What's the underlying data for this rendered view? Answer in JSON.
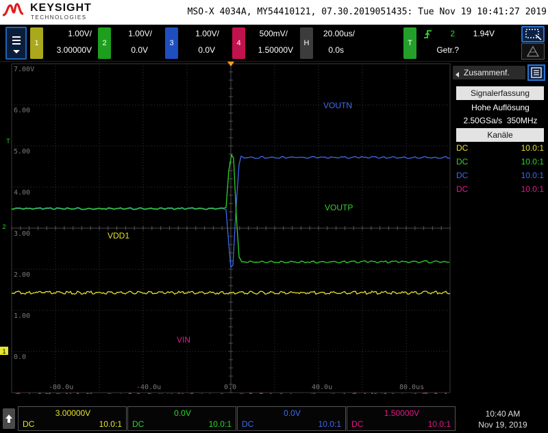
{
  "header": {
    "brand": "KEYSIGHT",
    "brand_sub": "TECHNOLOGIES",
    "status_line": "MSO-X 4034A, MY54410121, 07.30.2019051435: Tue Nov 19 10:41:27 2019"
  },
  "colors": {
    "ch1": "#e6e62a",
    "ch2": "#2fd62a",
    "ch3": "#3f6bf0",
    "ch4": "#e4178a",
    "grid": "#3a3a3a",
    "trigger": "#ff9e1b",
    "dim_text": "#7a7a7a"
  },
  "channels": [
    {
      "num": "1",
      "scale": "1.00V/",
      "offset": "3.00000V"
    },
    {
      "num": "2",
      "scale": "1.00V/",
      "offset": "0.0V"
    },
    {
      "num": "3",
      "scale": "1.00V/",
      "offset": "0.0V"
    },
    {
      "num": "4",
      "scale": "500mV/",
      "offset": "1.50000V"
    }
  ],
  "horizontal": {
    "label": "H",
    "scale": "20.00us/",
    "delay": "0.0s"
  },
  "trigger": {
    "label": "T",
    "edge_icon": "rising-edge-icon",
    "source": "2",
    "level": "1.94V",
    "status": "Getr.?"
  },
  "right_panel": {
    "tab_label": "Zusammenf.",
    "acq_button": "Signalerfassung",
    "acq_mode": "Hohe Auflösung",
    "sample_rate": "2.50GSa/s",
    "bandwidth": "350MHz",
    "channels_button": "Kanäle",
    "channel_rows": [
      {
        "coupling": "DC",
        "probe": "10.0:1"
      },
      {
        "coupling": "DC",
        "probe": "10.0:1"
      },
      {
        "coupling": "DC",
        "probe": "10.0:1"
      },
      {
        "coupling": "DC",
        "probe": "10.0:1"
      }
    ]
  },
  "graticule": {
    "y_labels": [
      "7.00V",
      "6.00",
      "5.00",
      "4.00",
      "3.00",
      "2.00",
      "1.00",
      "0.0"
    ],
    "x_labels": [
      "-80.0u",
      "-40.0u",
      "0.0",
      "40.0u",
      "80.0us"
    ],
    "trace_labels": [
      "VOUTN",
      "VOUTP",
      "VDD1",
      "VIN"
    ],
    "markers": [
      "T",
      "2",
      "1"
    ]
  },
  "bottom_bar": {
    "channel_boxes": [
      {
        "offset": "3.00000V",
        "coupling": "DC",
        "probe": "10.0:1"
      },
      {
        "offset": "0.0V",
        "coupling": "DC",
        "probe": "10.0:1"
      },
      {
        "offset": "0.0V",
        "coupling": "DC",
        "probe": "10.0:1"
      },
      {
        "offset": "1.50000V",
        "coupling": "DC",
        "probe": "10.0:1"
      }
    ],
    "time": "10:40 AM",
    "date": "Nov 19, 2019"
  }
}
